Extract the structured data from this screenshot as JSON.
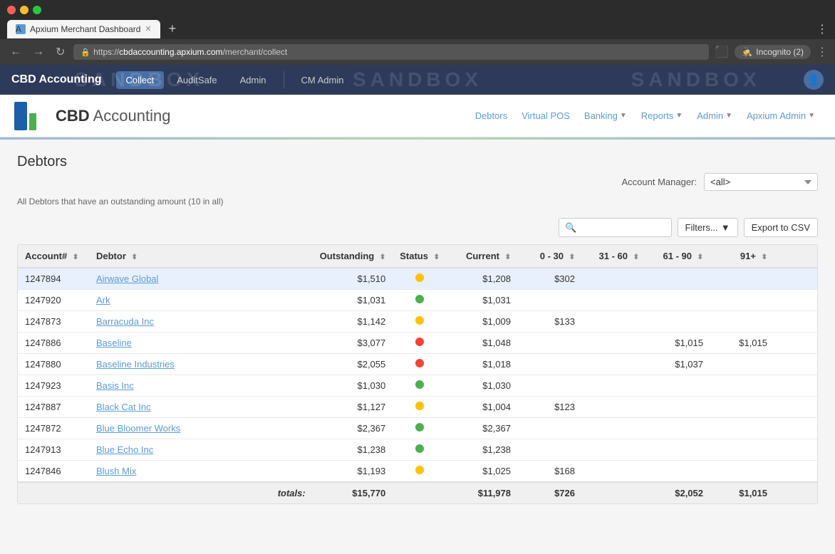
{
  "browser": {
    "tab_title": "Apxium Merchant Dashboard",
    "tab_favicon": "A",
    "url_prefix": "https://",
    "url_base": "cbdaccounting.apxium.com",
    "url_path": "/merchant/collect",
    "incognito_label": "Incognito (2)"
  },
  "app_header": {
    "logo_text": "CBD Accounting",
    "nav_items": [
      {
        "label": "Collect",
        "active": true
      },
      {
        "label": "AuditSafe",
        "active": false
      },
      {
        "label": "Admin",
        "active": false
      }
    ],
    "cm_admin": "CM Admin",
    "sandbox_texts": [
      "SANDBOX",
      "SANDBOX",
      "SANDBOX"
    ]
  },
  "second_nav": {
    "brand_first": "CBD",
    "brand_second": "Accounting",
    "links": [
      {
        "label": "Debtors",
        "has_dropdown": false
      },
      {
        "label": "Virtual POS",
        "has_dropdown": false
      },
      {
        "label": "Banking",
        "has_dropdown": true
      },
      {
        "label": "Reports",
        "has_dropdown": true
      },
      {
        "label": "Admin",
        "has_dropdown": true
      },
      {
        "label": "Apxium Admin",
        "has_dropdown": true
      }
    ]
  },
  "page": {
    "title": "Debtors",
    "subtitle": "All Debtors that have an outstanding amount (10 in all)",
    "account_manager_label": "Account Manager:",
    "account_manager_value": "<all>",
    "search_placeholder": "",
    "filters_label": "Filters...",
    "export_label": "Export to CSV"
  },
  "table": {
    "columns": [
      {
        "label": "Account#",
        "sortable": true
      },
      {
        "label": "Debtor",
        "sortable": true
      },
      {
        "label": "Outstanding",
        "sortable": true
      },
      {
        "label": "Status",
        "sortable": true
      },
      {
        "label": "Current",
        "sortable": true
      },
      {
        "label": "0 - 30",
        "sortable": true
      },
      {
        "label": "31 - 60",
        "sortable": true
      },
      {
        "label": "61 - 90",
        "sortable": true
      },
      {
        "label": "91+",
        "sortable": true
      },
      {
        "label": "",
        "sortable": false
      }
    ],
    "rows": [
      {
        "account": "1247894",
        "debtor": "Airwave Global",
        "outstanding": "$1,510",
        "status": "yellow",
        "current": "$1,208",
        "d0_30": "$302",
        "d31_60": "",
        "d61_90": "",
        "d91": "",
        "highlighted": true
      },
      {
        "account": "1247920",
        "debtor": "Ark",
        "outstanding": "$1,031",
        "status": "green",
        "current": "$1,031",
        "d0_30": "",
        "d31_60": "",
        "d61_90": "",
        "d91": ""
      },
      {
        "account": "1247873",
        "debtor": "Barracuda Inc",
        "outstanding": "$1,142",
        "status": "yellow",
        "current": "$1,009",
        "d0_30": "$133",
        "d31_60": "",
        "d61_90": "",
        "d91": ""
      },
      {
        "account": "1247886",
        "debtor": "Baseline",
        "outstanding": "$3,077",
        "status": "red",
        "current": "$1,048",
        "d0_30": "",
        "d31_60": "",
        "d61_90": "$1,015",
        "d91": "$1,015"
      },
      {
        "account": "1247880",
        "debtor": "Baseline Industries",
        "outstanding": "$2,055",
        "status": "red",
        "current": "$1,018",
        "d0_30": "",
        "d31_60": "",
        "d61_90": "$1,037",
        "d91": ""
      },
      {
        "account": "1247923",
        "debtor": "Basis Inc",
        "outstanding": "$1,030",
        "status": "green",
        "current": "$1,030",
        "d0_30": "",
        "d31_60": "",
        "d61_90": "",
        "d91": ""
      },
      {
        "account": "1247887",
        "debtor": "Black Cat Inc",
        "outstanding": "$1,127",
        "status": "yellow",
        "current": "$1,004",
        "d0_30": "$123",
        "d31_60": "",
        "d61_90": "",
        "d91": ""
      },
      {
        "account": "1247872",
        "debtor": "Blue Bloomer Works",
        "outstanding": "$2,367",
        "status": "green",
        "current": "$2,367",
        "d0_30": "",
        "d31_60": "",
        "d61_90": "",
        "d91": ""
      },
      {
        "account": "1247913",
        "debtor": "Blue Echo Inc",
        "outstanding": "$1,238",
        "status": "green",
        "current": "$1,238",
        "d0_30": "",
        "d31_60": "",
        "d61_90": "",
        "d91": ""
      },
      {
        "account": "1247846",
        "debtor": "Blush Mix",
        "outstanding": "$1,193",
        "status": "yellow",
        "current": "$1,025",
        "d0_30": "$168",
        "d31_60": "",
        "d61_90": "",
        "d91": ""
      }
    ],
    "totals": {
      "label": "totals:",
      "outstanding": "$15,770",
      "current": "$11,978",
      "d0_30": "$726",
      "d31_60": "",
      "d61_90": "$2,052",
      "d91": "$1,015"
    }
  }
}
